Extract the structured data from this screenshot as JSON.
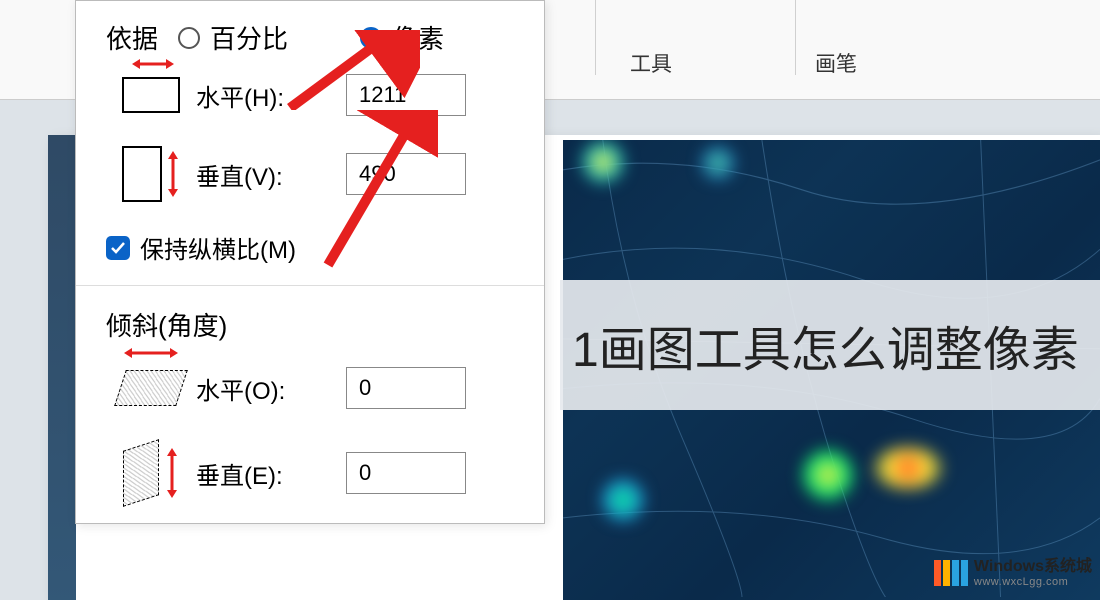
{
  "ribbon": {
    "tools_label": "工具",
    "brush_label": "画笔"
  },
  "dialog": {
    "by_label": "依据",
    "option_percent": "百分比",
    "option_pixel": "像素",
    "selected": "pixel",
    "horizontal_h_label": "水平(H):",
    "vertical_v_label": "垂直(V):",
    "horizontal_value": "1211",
    "vertical_value": "490",
    "maintain_aspect_label": "保持纵横比(M)",
    "maintain_aspect_checked": true,
    "skew_title": "倾斜(角度)",
    "skew_horizontal_label": "水平(O):",
    "skew_vertical_label": "垂直(E):",
    "skew_horizontal_value": "0",
    "skew_vertical_value": "0"
  },
  "canvas": {
    "overlay_title": "1画图工具怎么调整像素"
  },
  "watermark": {
    "title": "Windows系统城",
    "url": "www.wxcLgg.com"
  }
}
